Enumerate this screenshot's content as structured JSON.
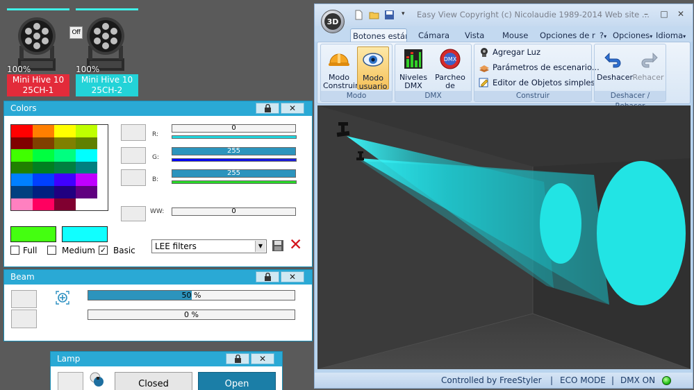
{
  "fixtures": [
    {
      "percent": "100%",
      "name": "Mini Hive 10",
      "channel": "25CH-1",
      "color": "#e32b3a"
    },
    {
      "percent": "100%",
      "name": "Mini Hive 10",
      "channel": "25CH-2",
      "color": "#23d3d8"
    }
  ],
  "off_badge": "Off",
  "colors_panel": {
    "title": "Colors",
    "palette": [
      "#ff0000",
      "#ff7f00",
      "#ffff00",
      "#bfff00",
      "#800000",
      "#804000",
      "#808000",
      "#608000",
      "#40ff00",
      "#00ff40",
      "#00ff80",
      "#00ffff",
      "#208000",
      "#008020",
      "#008040",
      "#008080",
      "#0080ff",
      "#0040ff",
      "#4000ff",
      "#bf00ff",
      "#004080",
      "#002080",
      "#200080",
      "#600080",
      "#ff80c0",
      "#ff0060",
      "#800030",
      "#ffffff"
    ],
    "channels": [
      {
        "label": "R:",
        "value": "0",
        "level": 0,
        "bar_color": "#20d8e0"
      },
      {
        "label": "G:",
        "value": "255",
        "level": 1,
        "bar_color": "#1f1fd8"
      },
      {
        "label": "B:",
        "value": "255",
        "level": 1,
        "bar_color": "#28d828"
      }
    ],
    "ww": {
      "label": "WW:",
      "value": "0",
      "level": 0
    },
    "swatch_primary": "#44ff10",
    "swatch_secondary": "#10ffff",
    "checkboxes": [
      {
        "label": "Full",
        "checked": false
      },
      {
        "label": "Medium",
        "checked": false
      },
      {
        "label": "Basic",
        "checked": true
      }
    ],
    "check_mark": "✓",
    "filter_select": "LEE filters",
    "delete_glyph": "✕"
  },
  "beam_panel": {
    "title": "Beam",
    "sliders": [
      {
        "value": "50 %",
        "level": 0.5
      },
      {
        "value": "0 %",
        "level": 0
      }
    ]
  },
  "lamp_panel": {
    "title": "Lamp",
    "closed_label": "Closed",
    "open_label": "Open"
  },
  "panel_close_glyph": "✕",
  "window": {
    "orb_label": "3D",
    "title": "Easy View   Copyright (c) Nicolaudie 1989-2014   Web site ...",
    "controls": [
      "–",
      "□",
      "✕"
    ],
    "tabs": [
      "Botones estánc",
      "Cámara",
      "Vista",
      "Mouse",
      "Opciones de re",
      "?",
      "Opciones",
      "Idioma"
    ],
    "groups": [
      {
        "caption": "Modo",
        "buttons": [
          {
            "label": "Modo Construir",
            "icon": "hard-hat-icon"
          },
          {
            "label": "Modo usuario",
            "icon": "eye-icon",
            "selected": true
          }
        ]
      },
      {
        "caption": "DMX",
        "buttons": [
          {
            "label": "Niveles DMX",
            "icon": "dmx-levels-icon"
          },
          {
            "label": "Parcheo de Universos",
            "icon": "dmx-patch-icon"
          }
        ]
      },
      {
        "caption": "Construir",
        "items": [
          {
            "label": "Agregar Luz",
            "icon": "add-light-icon"
          },
          {
            "label": "Parámetros de escenario...",
            "icon": "stage-params-icon"
          },
          {
            "label": "Editor de Objetos simples",
            "icon": "object-editor-icon"
          }
        ]
      },
      {
        "caption": "Deshacer / Rehacer",
        "buttons": [
          {
            "label": "Deshacer",
            "icon": "undo-icon"
          },
          {
            "label": "Rehacer",
            "icon": "redo-icon",
            "disabled": true
          }
        ]
      }
    ],
    "status": {
      "controlled": "Controlled by FreeStyler",
      "eco": "ECO MODE",
      "dmx": "DMX ON",
      "sep": "|",
      "led_color": "#2ad11e"
    },
    "beam_color": "#22e4e4"
  }
}
